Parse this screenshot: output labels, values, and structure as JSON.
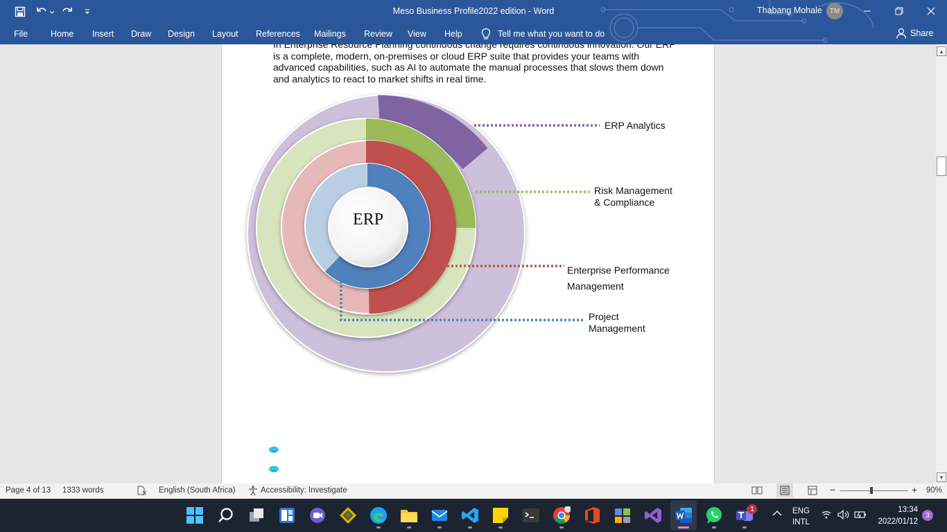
{
  "titlebar": {
    "doc_title": "Meso Business Profile2022 edition  -  Word",
    "user_name": "Thabang Mohale",
    "avatar_initials": "TM"
  },
  "ribbon": {
    "file": "File",
    "tabs": [
      "Home",
      "Insert",
      "Draw",
      "Design",
      "Layout",
      "References",
      "Mailings",
      "Review",
      "View",
      "Help"
    ],
    "tell_me": "Tell me what you want to do",
    "share": "Share"
  },
  "document": {
    "paragraph": "In Enterprise Resource Planning continuous change requires continuous innovation.  Our ERP is a complete, modern, on-premises or cloud ERP suite that provides your teams with advanced capabilities, such as AI to automate the manual processes that slows them down and analytics to react to market shifts in real time.",
    "diagram": {
      "center_label": "ERP",
      "labels": {
        "analytics": "ERP Analytics",
        "risk_1": "Risk Management",
        "risk_2": "& Compliance",
        "epm_1": "Enterprise Performance",
        "epm_2": "Management",
        "project_1": "Project",
        "project_2": "Management"
      },
      "colors": {
        "analytics": "#8064a2",
        "risk": "#9bbb59",
        "epm": "#c0504d",
        "project": "#4f81bd"
      }
    }
  },
  "statusbar": {
    "page": "Page 4 of 13",
    "words": "1333 words",
    "language": "English (South Africa)",
    "accessibility": "Accessibility: Investigate",
    "zoom_minus": "−",
    "zoom_plus": "+",
    "zoom": "90%"
  },
  "taskbar": {
    "lang_1": "ENG",
    "lang_2": "INTL",
    "time": "13:34",
    "date": "2022/01/12",
    "notification_count": "3",
    "teams_badge": "1"
  }
}
